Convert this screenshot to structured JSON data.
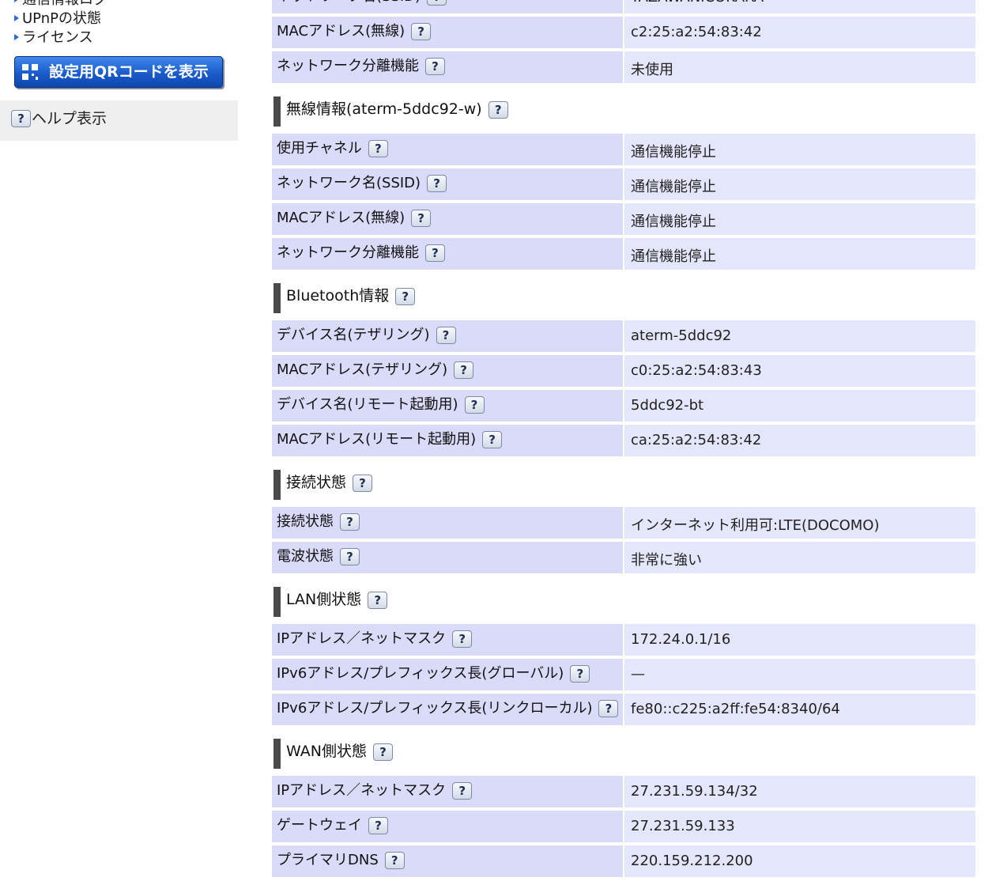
{
  "sidebar": {
    "links": [
      "通信情報ログ",
      "UPnPの状態",
      "ライセンス"
    ],
    "qr_button": "設定用QRコードを表示",
    "help": "ヘルプ表示"
  },
  "help_symbol": "?",
  "sections": [
    {
      "title": null,
      "rows": [
        {
          "label": "ネットワーク名(SSID)",
          "value": "YAZAWANICOKARA"
        },
        {
          "label": "MACアドレス(無線)",
          "value": "c2:25:a2:54:83:42"
        },
        {
          "label": "ネットワーク分離機能",
          "value": "未使用"
        }
      ]
    },
    {
      "title": "無線情報(aterm-5ddc92-w)",
      "rows": [
        {
          "label": "使用チャネル",
          "value": "通信機能停止"
        },
        {
          "label": "ネットワーク名(SSID)",
          "value": "通信機能停止"
        },
        {
          "label": "MACアドレス(無線)",
          "value": "通信機能停止"
        },
        {
          "label": "ネットワーク分離機能",
          "value": "通信機能停止"
        }
      ]
    },
    {
      "title": "Bluetooth情報",
      "rows": [
        {
          "label": "デバイス名(テザリング)",
          "value": "aterm-5ddc92"
        },
        {
          "label": "MACアドレス(テザリング)",
          "value": "c0:25:a2:54:83:43"
        },
        {
          "label": "デバイス名(リモート起動用)",
          "value": "5ddc92-bt"
        },
        {
          "label": "MACアドレス(リモート起動用)",
          "value": "ca:25:a2:54:83:42"
        }
      ]
    },
    {
      "title": "接続状態",
      "rows": [
        {
          "label": "接続状態",
          "value": "インターネット利用可:LTE(DOCOMO)"
        },
        {
          "label": "電波状態",
          "value": "非常に強い"
        }
      ]
    },
    {
      "title": "LAN側状態",
      "rows": [
        {
          "label": "IPアドレス／ネットマスク",
          "value": "172.24.0.1/16"
        },
        {
          "label": "IPv6アドレス/プレフィックス長(グローバル)",
          "value": "—"
        },
        {
          "label": "IPv6アドレス/プレフィックス長(リンクローカル)",
          "value": "fe80::c225:a2ff:fe54:8340/64"
        }
      ]
    },
    {
      "title": "WAN側状態",
      "rows": [
        {
          "label": "IPアドレス／ネットマスク",
          "value": "27.231.59.134/32"
        },
        {
          "label": "ゲートウェイ",
          "value": "27.231.59.133"
        },
        {
          "label": "プライマリDNS",
          "value": "220.159.212.200"
        }
      ]
    }
  ]
}
